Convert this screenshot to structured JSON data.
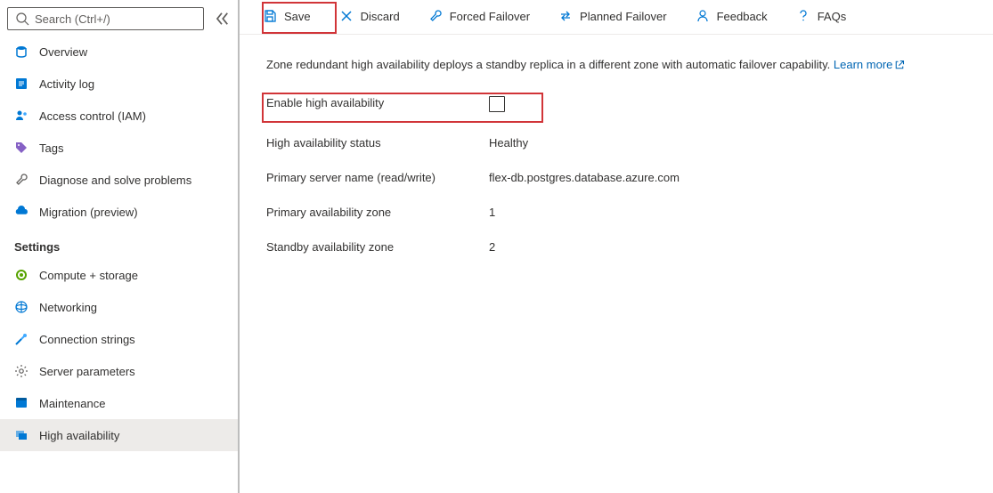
{
  "sidebar": {
    "search_placeholder": "Search (Ctrl+/)",
    "items": [
      {
        "label": "Overview"
      },
      {
        "label": "Activity log"
      },
      {
        "label": "Access control (IAM)"
      },
      {
        "label": "Tags"
      },
      {
        "label": "Diagnose and solve problems"
      },
      {
        "label": "Migration (preview)"
      }
    ],
    "settings_heading": "Settings",
    "settings": [
      {
        "label": "Compute + storage"
      },
      {
        "label": "Networking"
      },
      {
        "label": "Connection strings"
      },
      {
        "label": "Server parameters"
      },
      {
        "label": "Maintenance"
      },
      {
        "label": "High availability"
      }
    ]
  },
  "toolbar": {
    "save_label": "Save",
    "discard_label": "Discard",
    "forced_failover_label": "Forced Failover",
    "planned_failover_label": "Planned Failover",
    "feedback_label": "Feedback",
    "faqs_label": "FAQs"
  },
  "main": {
    "intro_text": "Zone redundant high availability deploys a standby replica in a different zone with automatic failover capability. ",
    "learn_more_label": "Learn more",
    "rows": {
      "enable_label": "Enable high availability",
      "status_label": "High availability status",
      "status_value": "Healthy",
      "primary_name_label": "Primary server name (read/write)",
      "primary_name_value": "flex-db.postgres.database.azure.com",
      "primary_zone_label": "Primary availability zone",
      "primary_zone_value": "1",
      "standby_zone_label": "Standby availability zone",
      "standby_zone_value": "2"
    }
  }
}
